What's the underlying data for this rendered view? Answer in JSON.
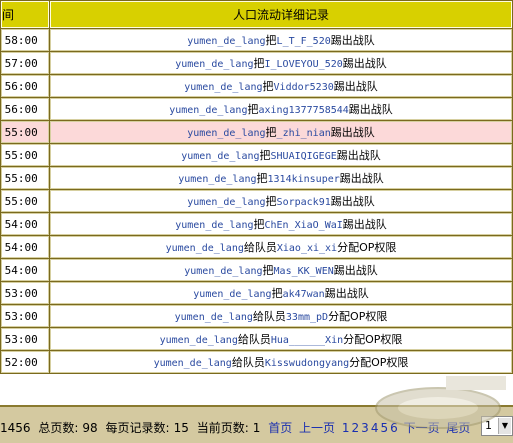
{
  "header": {
    "time_col": "间",
    "record_col": "人口流动详细记录"
  },
  "rows": [
    {
      "time": ":58:00",
      "name": "yumen_de_lang",
      "verb": "把",
      "obj": "L_T_F_520",
      "result": "踢出战队",
      "highlight": false
    },
    {
      "time": ":57:00",
      "name": "yumen_de_lang",
      "verb": "把",
      "obj": "I_LOVEYOU_520",
      "result": "踢出战队",
      "highlight": false
    },
    {
      "time": ":56:00",
      "name": "yumen_de_lang",
      "verb": "把",
      "obj": "Viddor5230",
      "result": "踢出战队",
      "highlight": false
    },
    {
      "time": ":56:00",
      "name": "yumen_de_lang",
      "verb": "把",
      "obj": "axing1377758544",
      "result": "踢出战队",
      "highlight": false
    },
    {
      "time": ":55:00",
      "name": "yumen_de_lang",
      "verb": "把",
      "obj": "_zhi_nian",
      "result": "踢出战队",
      "highlight": true
    },
    {
      "time": ":55:00",
      "name": "yumen_de_lang",
      "verb": "把",
      "obj": "SHUAIQIGEGE",
      "result": "踢出战队",
      "highlight": false
    },
    {
      "time": ":55:00",
      "name": "yumen_de_lang",
      "verb": "把",
      "obj": "1314kinsuper",
      "result": "踢出战队",
      "highlight": false
    },
    {
      "time": ":55:00",
      "name": "yumen_de_lang",
      "verb": "把",
      "obj": "Sorpack91",
      "result": "踢出战队",
      "highlight": false
    },
    {
      "time": ":54:00",
      "name": "yumen_de_lang",
      "verb": "把",
      "obj": "ChEn_XiaO_WaI",
      "result": "踢出战队",
      "highlight": false
    },
    {
      "time": ":54:00",
      "name": "yumen_de_lang",
      "verb": "给队员",
      "obj": "Xiao_xi_xi",
      "result": "分配OP权限",
      "highlight": false
    },
    {
      "time": ":54:00",
      "name": "yumen_de_lang",
      "verb": "把",
      "obj": "Mas_KK_WEN",
      "result": "踢出战队",
      "highlight": false
    },
    {
      "time": ":53:00",
      "name": "yumen_de_lang",
      "verb": "把",
      "obj": "ak47wan",
      "result": "踢出战队",
      "highlight": false
    },
    {
      "time": ":53:00",
      "name": "yumen_de_lang",
      "verb": "给队员",
      "obj": "33mm_pD",
      "result": "分配OP权限",
      "highlight": false
    },
    {
      "time": ":53:00",
      "name": "yumen_de_lang",
      "verb": "给队员",
      "obj": "Hua______Xin",
      "result": "分配OP权限",
      "highlight": false
    },
    {
      "time": ":52:00",
      "name": "yumen_de_lang",
      "verb": "给队员",
      "obj": "Kisswudongyang",
      "result": "分配OP权限",
      "highlight": false
    }
  ],
  "pager": {
    "total": "1456",
    "total_pages_label": "总页数:",
    "total_pages": "98",
    "per_page_label": "每页记录数:",
    "per_page": "15",
    "current_label": "当前页数:",
    "current": "1",
    "first": "首页",
    "prev": "上一页",
    "pages": [
      "1",
      "2",
      "3",
      "4",
      "5",
      "6"
    ],
    "next": "下一页",
    "last": "尾页",
    "select_value": "1"
  }
}
